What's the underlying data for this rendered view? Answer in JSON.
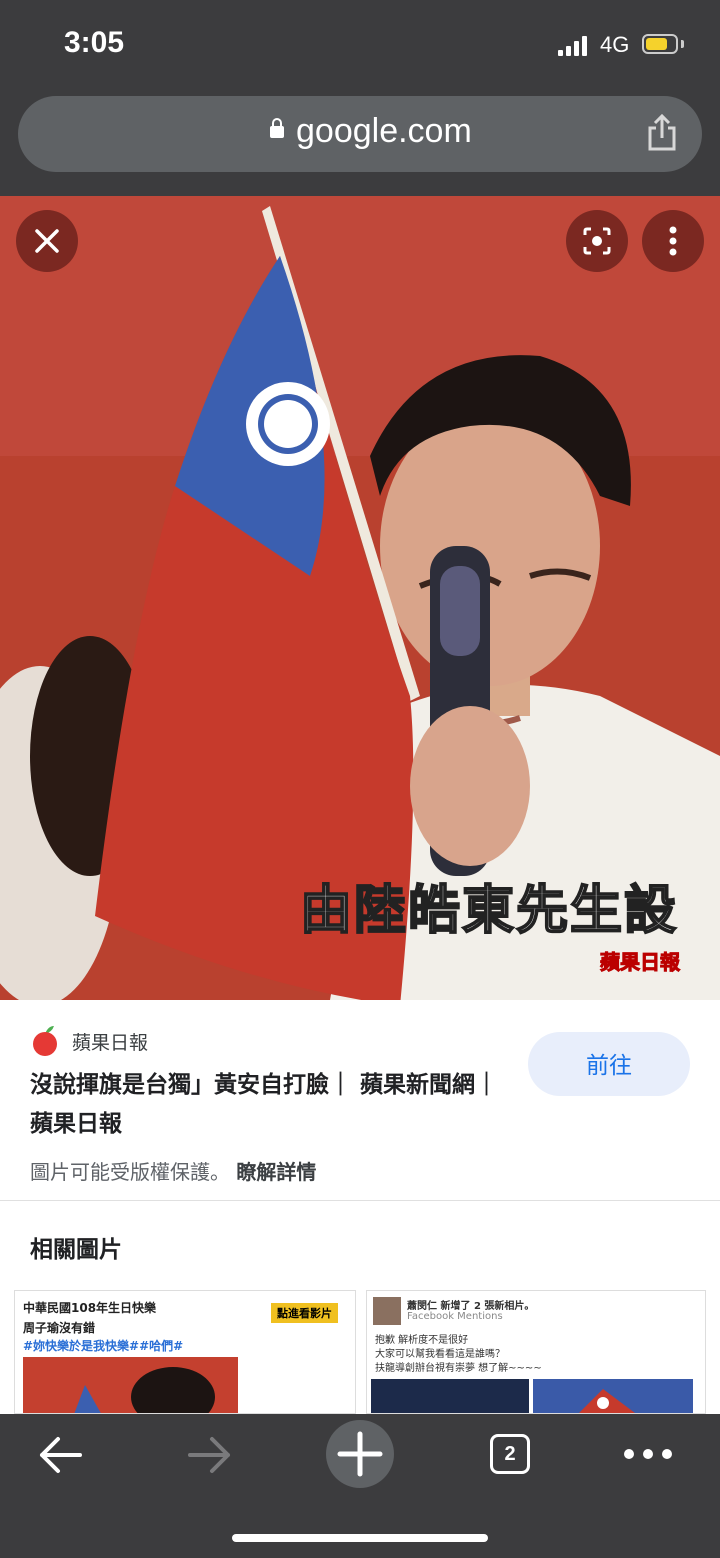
{
  "status": {
    "time": "3:05",
    "network": "4G",
    "battery_level": 0.75
  },
  "browser": {
    "url": "google.com"
  },
  "image": {
    "overlay_text": "由陸皓東先生設",
    "watermark": "蘋果日報"
  },
  "result": {
    "source_name": "蘋果日報",
    "title": "沒說揮旗是台獨」黃安自打臉｜ 蘋果新聞網｜ 蘋果日報",
    "visit_label": "前往",
    "copyright_text": "圖片可能受版權保護。",
    "learn_more": "瞭解詳情"
  },
  "related": {
    "heading": "相關圖片",
    "thumb1": {
      "line1": "中華民國108年生日快樂",
      "line2": "周子瑜沒有錯",
      "line3": "#妳快樂於是我快樂##哈們#",
      "badge": "點進看影片"
    },
    "thumb2": {
      "line1": "蕭閔仁 新增了 2 張新相片。",
      "line2": "Facebook Mentions",
      "line3": "抱歉 解析度不是很好",
      "line4": "大家可以幫我看看這是誰嗎？",
      "line5": "扶龍導創辦台視有崇夢 想了解~~~~"
    }
  },
  "toolbar": {
    "tab_count": "2"
  },
  "colors": {
    "chrome_bg": "#3c3c3e",
    "url_pill": "#5f6265",
    "accent": "#1a73e8",
    "visit_bg": "#e8eefb"
  }
}
